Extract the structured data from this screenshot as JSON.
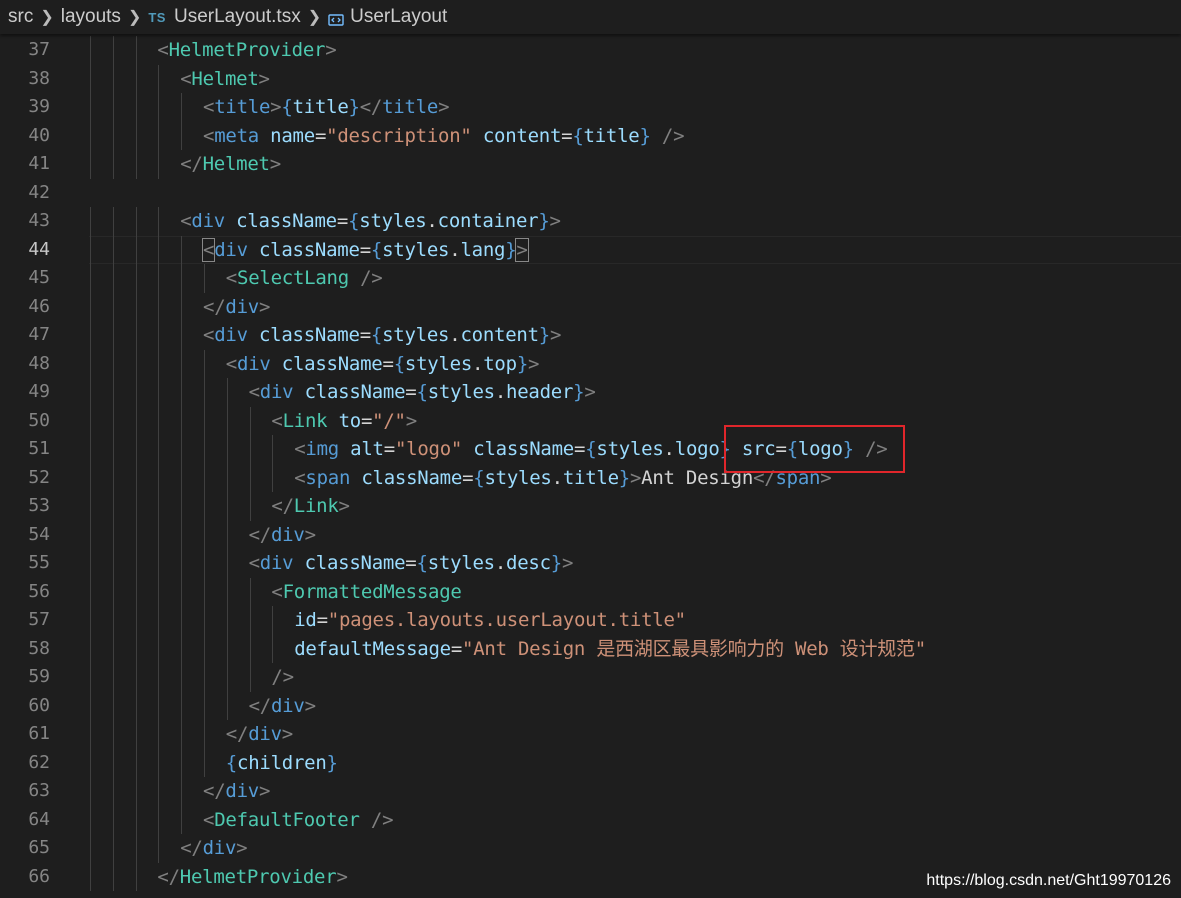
{
  "breadcrumb": {
    "items": [
      "src",
      "layouts",
      "UserLayout.tsx",
      "UserLayout"
    ],
    "file_badge": "TS",
    "file_icon": "typescript-file-icon",
    "symbol_icon": "component-symbol-icon"
  },
  "editor": {
    "active_line": 44,
    "lines": [
      {
        "num": "37",
        "indent": 3,
        "tokens": [
          [
            "p",
            "<"
          ],
          [
            "c",
            "HelmetProvider"
          ],
          [
            "p",
            ">"
          ]
        ]
      },
      {
        "num": "38",
        "indent": 4,
        "tokens": [
          [
            "p",
            "<"
          ],
          [
            "c",
            "Helmet"
          ],
          [
            "p",
            ">"
          ]
        ]
      },
      {
        "num": "39",
        "indent": 5,
        "tokens": [
          [
            "p",
            "<"
          ],
          [
            "t",
            "title"
          ],
          [
            "p",
            ">"
          ],
          [
            "b",
            "{"
          ],
          [
            "a",
            "title"
          ],
          [
            "b",
            "}"
          ],
          [
            "p",
            "</"
          ],
          [
            "t",
            "title"
          ],
          [
            "p",
            ">"
          ]
        ]
      },
      {
        "num": "40",
        "indent": 5,
        "tokens": [
          [
            "p",
            "<"
          ],
          [
            "t",
            "meta"
          ],
          [
            "x",
            " "
          ],
          [
            "a",
            "name"
          ],
          [
            "x",
            "="
          ],
          [
            "s",
            "\"description\""
          ],
          [
            "x",
            " "
          ],
          [
            "a",
            "content"
          ],
          [
            "x",
            "="
          ],
          [
            "b",
            "{"
          ],
          [
            "a",
            "title"
          ],
          [
            "b",
            "}"
          ],
          [
            "x",
            " "
          ],
          [
            "p",
            "/>"
          ]
        ]
      },
      {
        "num": "41",
        "indent": 4,
        "tokens": [
          [
            "p",
            "</"
          ],
          [
            "c",
            "Helmet"
          ],
          [
            "p",
            ">"
          ]
        ]
      },
      {
        "num": "42",
        "indent": 0,
        "tokens": []
      },
      {
        "num": "43",
        "indent": 4,
        "tokens": [
          [
            "p",
            "<"
          ],
          [
            "t",
            "div"
          ],
          [
            "x",
            " "
          ],
          [
            "a",
            "className"
          ],
          [
            "x",
            "="
          ],
          [
            "b",
            "{"
          ],
          [
            "a",
            "styles"
          ],
          [
            "x",
            "."
          ],
          [
            "a",
            "container"
          ],
          [
            "b",
            "}"
          ],
          [
            "p",
            ">"
          ]
        ]
      },
      {
        "num": "44",
        "indent": 5,
        "tokens": [
          [
            "pm",
            "<"
          ],
          [
            "t",
            "div"
          ],
          [
            "x",
            " "
          ],
          [
            "a",
            "className"
          ],
          [
            "x",
            "="
          ],
          [
            "b",
            "{"
          ],
          [
            "a",
            "styles"
          ],
          [
            "x",
            "."
          ],
          [
            "a",
            "lang"
          ],
          [
            "b",
            "}"
          ],
          [
            "pm",
            ">"
          ]
        ]
      },
      {
        "num": "45",
        "indent": 6,
        "tokens": [
          [
            "p",
            "<"
          ],
          [
            "c",
            "SelectLang"
          ],
          [
            "x",
            " "
          ],
          [
            "p",
            "/>"
          ]
        ]
      },
      {
        "num": "46",
        "indent": 5,
        "tokens": [
          [
            "p",
            "</"
          ],
          [
            "t",
            "div"
          ],
          [
            "p",
            ">"
          ]
        ]
      },
      {
        "num": "47",
        "indent": 5,
        "tokens": [
          [
            "p",
            "<"
          ],
          [
            "t",
            "div"
          ],
          [
            "x",
            " "
          ],
          [
            "a",
            "className"
          ],
          [
            "x",
            "="
          ],
          [
            "b",
            "{"
          ],
          [
            "a",
            "styles"
          ],
          [
            "x",
            "."
          ],
          [
            "a",
            "content"
          ],
          [
            "b",
            "}"
          ],
          [
            "p",
            ">"
          ]
        ]
      },
      {
        "num": "48",
        "indent": 6,
        "tokens": [
          [
            "p",
            "<"
          ],
          [
            "t",
            "div"
          ],
          [
            "x",
            " "
          ],
          [
            "a",
            "className"
          ],
          [
            "x",
            "="
          ],
          [
            "b",
            "{"
          ],
          [
            "a",
            "styles"
          ],
          [
            "x",
            "."
          ],
          [
            "a",
            "top"
          ],
          [
            "b",
            "}"
          ],
          [
            "p",
            ">"
          ]
        ]
      },
      {
        "num": "49",
        "indent": 7,
        "tokens": [
          [
            "p",
            "<"
          ],
          [
            "t",
            "div"
          ],
          [
            "x",
            " "
          ],
          [
            "a",
            "className"
          ],
          [
            "x",
            "="
          ],
          [
            "b",
            "{"
          ],
          [
            "a",
            "styles"
          ],
          [
            "x",
            "."
          ],
          [
            "a",
            "header"
          ],
          [
            "b",
            "}"
          ],
          [
            "p",
            ">"
          ]
        ]
      },
      {
        "num": "50",
        "indent": 8,
        "tokens": [
          [
            "p",
            "<"
          ],
          [
            "c",
            "Link"
          ],
          [
            "x",
            " "
          ],
          [
            "a",
            "to"
          ],
          [
            "x",
            "="
          ],
          [
            "s",
            "\"/\""
          ],
          [
            "p",
            ">"
          ]
        ]
      },
      {
        "num": "51",
        "indent": 9,
        "tokens": [
          [
            "p",
            "<"
          ],
          [
            "t",
            "img"
          ],
          [
            "x",
            " "
          ],
          [
            "a",
            "alt"
          ],
          [
            "x",
            "="
          ],
          [
            "s",
            "\"logo\""
          ],
          [
            "x",
            " "
          ],
          [
            "a",
            "className"
          ],
          [
            "x",
            "="
          ],
          [
            "b",
            "{"
          ],
          [
            "a",
            "styles"
          ],
          [
            "x",
            "."
          ],
          [
            "a",
            "logo"
          ],
          [
            "b",
            "}"
          ],
          [
            "x",
            " "
          ],
          [
            "a",
            "src"
          ],
          [
            "x",
            "="
          ],
          [
            "b",
            "{"
          ],
          [
            "a",
            "logo"
          ],
          [
            "b",
            "}"
          ],
          [
            "x",
            " "
          ],
          [
            "p",
            "/>"
          ]
        ]
      },
      {
        "num": "52",
        "indent": 9,
        "tokens": [
          [
            "p",
            "<"
          ],
          [
            "t",
            "span"
          ],
          [
            "x",
            " "
          ],
          [
            "a",
            "className"
          ],
          [
            "x",
            "="
          ],
          [
            "b",
            "{"
          ],
          [
            "a",
            "styles"
          ],
          [
            "x",
            "."
          ],
          [
            "a",
            "title"
          ],
          [
            "b",
            "}"
          ],
          [
            "p",
            ">"
          ],
          [
            "x",
            "Ant Design"
          ],
          [
            "p",
            "</"
          ],
          [
            "t",
            "span"
          ],
          [
            "p",
            ">"
          ]
        ]
      },
      {
        "num": "53",
        "indent": 8,
        "tokens": [
          [
            "p",
            "</"
          ],
          [
            "c",
            "Link"
          ],
          [
            "p",
            ">"
          ]
        ]
      },
      {
        "num": "54",
        "indent": 7,
        "tokens": [
          [
            "p",
            "</"
          ],
          [
            "t",
            "div"
          ],
          [
            "p",
            ">"
          ]
        ]
      },
      {
        "num": "55",
        "indent": 7,
        "tokens": [
          [
            "p",
            "<"
          ],
          [
            "t",
            "div"
          ],
          [
            "x",
            " "
          ],
          [
            "a",
            "className"
          ],
          [
            "x",
            "="
          ],
          [
            "b",
            "{"
          ],
          [
            "a",
            "styles"
          ],
          [
            "x",
            "."
          ],
          [
            "a",
            "desc"
          ],
          [
            "b",
            "}"
          ],
          [
            "p",
            ">"
          ]
        ]
      },
      {
        "num": "56",
        "indent": 8,
        "tokens": [
          [
            "p",
            "<"
          ],
          [
            "c",
            "FormattedMessage"
          ]
        ]
      },
      {
        "num": "57",
        "indent": 9,
        "tokens": [
          [
            "a",
            "id"
          ],
          [
            "x",
            "="
          ],
          [
            "s",
            "\"pages.layouts.userLayout.title\""
          ]
        ]
      },
      {
        "num": "58",
        "indent": 9,
        "tokens": [
          [
            "a",
            "defaultMessage"
          ],
          [
            "x",
            "="
          ],
          [
            "s",
            "\"Ant Design 是西湖区最具影响力的 Web 设计规范\""
          ]
        ]
      },
      {
        "num": "59",
        "indent": 8,
        "tokens": [
          [
            "p",
            "/>"
          ]
        ]
      },
      {
        "num": "60",
        "indent": 7,
        "tokens": [
          [
            "p",
            "</"
          ],
          [
            "t",
            "div"
          ],
          [
            "p",
            ">"
          ]
        ]
      },
      {
        "num": "61",
        "indent": 6,
        "tokens": [
          [
            "p",
            "</"
          ],
          [
            "t",
            "div"
          ],
          [
            "p",
            ">"
          ]
        ]
      },
      {
        "num": "62",
        "indent": 6,
        "tokens": [
          [
            "b",
            "{"
          ],
          [
            "a",
            "children"
          ],
          [
            "b",
            "}"
          ]
        ]
      },
      {
        "num": "63",
        "indent": 5,
        "tokens": [
          [
            "p",
            "</"
          ],
          [
            "t",
            "div"
          ],
          [
            "p",
            ">"
          ]
        ]
      },
      {
        "num": "64",
        "indent": 5,
        "tokens": [
          [
            "p",
            "<"
          ],
          [
            "c",
            "DefaultFooter"
          ],
          [
            "x",
            " "
          ],
          [
            "p",
            "/>"
          ]
        ]
      },
      {
        "num": "65",
        "indent": 4,
        "tokens": [
          [
            "p",
            "</"
          ],
          [
            "t",
            "div"
          ],
          [
            "p",
            ">"
          ]
        ]
      },
      {
        "num": "66",
        "indent": 3,
        "tokens": [
          [
            "p",
            "</"
          ],
          [
            "c",
            "HelmetProvider"
          ],
          [
            "p",
            ">"
          ]
        ]
      }
    ]
  },
  "colors": {
    "background": "#1e1e1e",
    "highlight_box": "#e0262b"
  },
  "watermark": "https://blog.csdn.net/Ght19970126"
}
